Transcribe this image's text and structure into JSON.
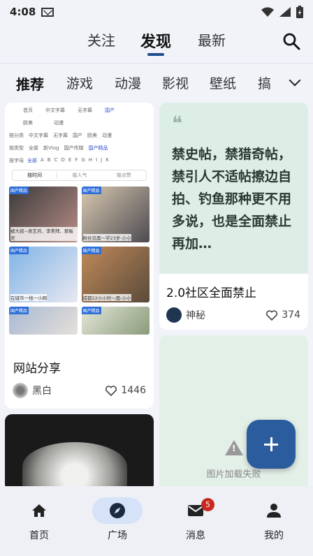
{
  "status_bar": {
    "time": "4:08"
  },
  "top_tabs": [
    "关注",
    "发现",
    "最新"
  ],
  "categories": [
    "推荐",
    "游戏",
    "动漫",
    "影视",
    "壁纸",
    "搞"
  ],
  "posts": [
    {
      "title": "网站分享",
      "author": "黑白",
      "likes": "1446",
      "screenshot": {
        "nav_row": [
          "首页",
          "中文字幕",
          "无字幕",
          "国产"
        ],
        "nav_row2": [
          "欧美",
          "动漫"
        ],
        "filter_row1": [
          "按分类",
          "中文字幕",
          "无字幕",
          "国产",
          "欧美",
          "动漫"
        ],
        "filter_row2": [
          "按类型",
          "全部",
          "新Vlog",
          "国产传媒",
          "国产精品"
        ],
        "filter_row3": [
          "按字母",
          "全部",
          "A",
          "B",
          "C",
          "D",
          "E",
          "F",
          "G",
          "H",
          "I",
          "J",
          "K"
        ],
        "sort_tabs": [
          "按时间",
          "按人气",
          "按点赞"
        ],
        "thumb_tag": "国产精品",
        "thumb_captions": [
          "被大叔~表艺月、李美拜、那板灵",
          "粉丝见面～学23岁-小小",
          "在城市一线一小网",
          "成都22小小时～面-小小",
          "",
          ""
        ]
      }
    },
    {
      "quote": "禁史帖，禁猎奇帖，禁引人不适帖擦边自拍、钓鱼那种更不用多说，也是全面禁止 再加…",
      "title": "2.0社区全面禁止",
      "author": "神秘",
      "likes": "374"
    },
    {
      "failed_text": "图片加载失败"
    }
  ],
  "bottom_nav": [
    {
      "label": "首页",
      "icon": "home-icon"
    },
    {
      "label": "广场",
      "icon": "compass-icon"
    },
    {
      "label": "消息",
      "icon": "mail-icon",
      "badge": "5"
    },
    {
      "label": "我的",
      "icon": "person-icon"
    }
  ],
  "colors": {
    "accent": "#1e4e8c",
    "fab": "#2b5c9e",
    "badge": "#c8281e",
    "quote_bg": "#ddeee6"
  }
}
